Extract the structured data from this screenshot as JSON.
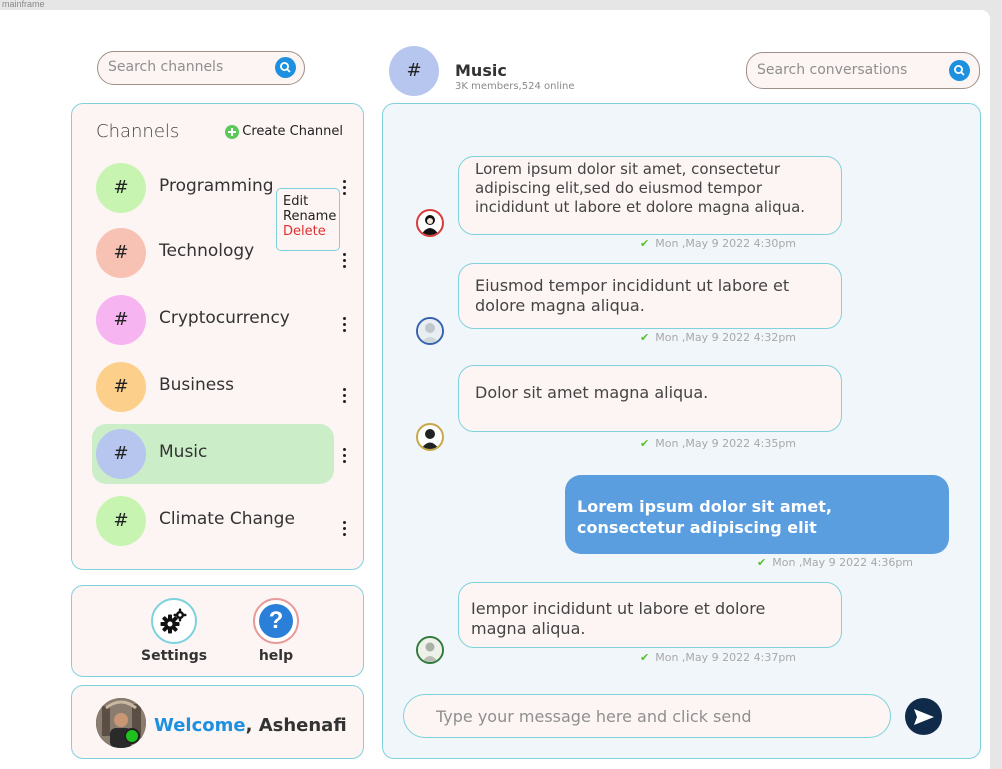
{
  "frame": {
    "label": "mainframe"
  },
  "sidebar": {
    "search": {
      "placeholder": "Search channels"
    },
    "channels": {
      "title": "Channels",
      "create_label": "Create Channel",
      "items": [
        {
          "name": "Programming",
          "symbol": "#",
          "color": "#c7f5b1"
        },
        {
          "name": "Technology",
          "symbol": "#",
          "color": "#f7c2b4"
        },
        {
          "name": "Cryptocurrency",
          "symbol": "#",
          "color": "#f6b4f0"
        },
        {
          "name": "Business",
          "symbol": "#",
          "color": "#fcd08b"
        },
        {
          "name": "Music",
          "symbol": "#",
          "color": "#b7c6ef"
        },
        {
          "name": "Climate Change",
          "symbol": "#",
          "color": "#c7f5b1"
        }
      ],
      "active_index": 4,
      "context_menu": {
        "items": [
          "Edit",
          "Rename",
          "Delete"
        ]
      }
    },
    "tools": {
      "settings_label": "Settings",
      "help_label": "help"
    },
    "welcome": {
      "greeting": "Welcome",
      "name": ", Ashenafi"
    }
  },
  "header": {
    "symbol": "#",
    "title": "Music",
    "subtitle": "3K members,524 online",
    "search": {
      "placeholder": "Search conversations"
    }
  },
  "messages": [
    {
      "text": "Lorem ipsum dolor sit amet, consectetur adipiscing elit,sed do eiusmod tempor incididunt ut labore et dolore magna aliqua.",
      "time": "Mon ,May 9  2022  4:30pm",
      "direction": "in"
    },
    {
      "text": "Eiusmod tempor incididunt ut labore et dolore magna aliqua.",
      "time": "Mon ,May 9  2022  4:32pm",
      "direction": "in"
    },
    {
      "text": "Dolor sit amet magna aliqua.",
      "time": "Mon ,May 9  2022  4:35pm",
      "direction": "in"
    },
    {
      "text": "Lorem ipsum dolor sit amet, consectetur adipiscing elit",
      "time": "Mon ,May 9  2022  4:36pm",
      "direction": "out"
    },
    {
      "text": "Iempor incididunt ut labore et dolore magna aliqua.",
      "time": "Mon ,May 9  2022  4:37pm",
      "direction": "in"
    }
  ],
  "composer": {
    "placeholder": "Type your message here and click send"
  },
  "colors": {
    "accent": "#1e90e0",
    "border": "#7fd2dd",
    "outgoing_bubble": "#5a9ee0",
    "read_check": "#58c030",
    "danger": "#e23030"
  }
}
